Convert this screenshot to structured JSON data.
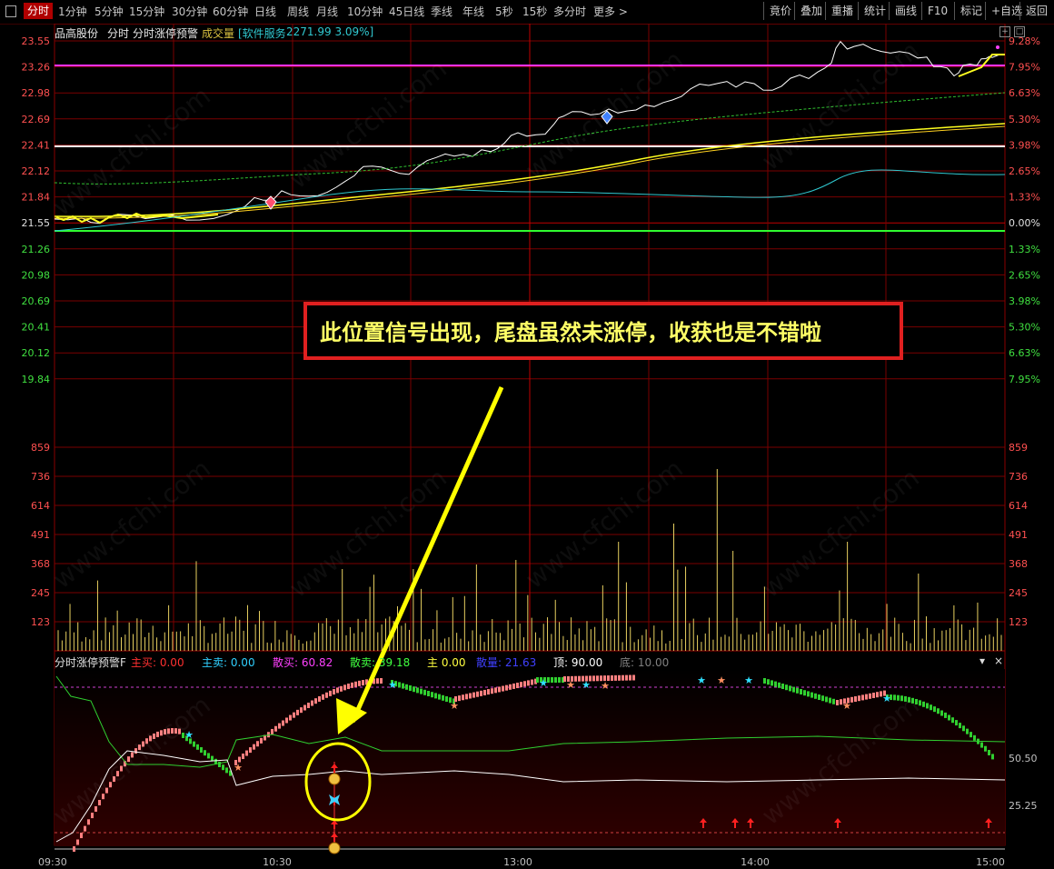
{
  "toolbar": {
    "tabs": [
      "分时",
      "1分钟",
      "5分钟",
      "15分钟",
      "30分钟",
      "60分钟",
      "日线",
      "周线",
      "月线",
      "10分钟",
      "45日线",
      "季线",
      "年线",
      "5秒",
      "15秒",
      "多分时",
      "更多 >"
    ],
    "right_buttons": [
      "竟价",
      "叠加",
      "重播",
      "统计",
      "画线",
      "F10",
      "标记",
      "+自选",
      "返回"
    ]
  },
  "header": {
    "stock_name": "品高股份",
    "mode": "分时",
    "indicator": "分时涨停预警",
    "volume_label": "成交量",
    "sector": "[软件服务",
    "sector_value": "2271.99 3.09%]"
  },
  "price_axis": {
    "left": [
      "23.55",
      "23.26",
      "22.98",
      "22.69",
      "22.41",
      "22.12",
      "21.84",
      "21.55",
      "21.26",
      "20.98",
      "20.69",
      "20.41",
      "20.12",
      "19.84"
    ],
    "right": [
      "9.28%",
      "7.95%",
      "6.63%",
      "5.30%",
      "3.98%",
      "2.65%",
      "1.33%",
      "0.00%",
      "1.33%",
      "2.65%",
      "3.98%",
      "5.30%",
      "6.63%",
      "7.95%"
    ]
  },
  "volume_axis": [
    "859",
    "736",
    "614",
    "491",
    "368",
    "245",
    "123"
  ],
  "indicator_legend": {
    "name": "分时涨停预警F",
    "items": [
      {
        "label": "主买:",
        "value": "0.00",
        "color": "#ff3030"
      },
      {
        "label": "主卖:",
        "value": "0.00",
        "color": "#30d0ff"
      },
      {
        "label": "散买:",
        "value": "60.82",
        "color": "#ff40ff"
      },
      {
        "label": "散卖:",
        "value": "39.18",
        "color": "#40ff40"
      },
      {
        "label": "主",
        "value": "0.00",
        "color": "#ffff40"
      },
      {
        "label": "散量:",
        "value": "21.63",
        "color": "#4040ff"
      },
      {
        "label": "顶:",
        "value": "90.00",
        "color": "#ffffff"
      },
      {
        "label": "底:",
        "value": "10.00",
        "color": "#808080"
      }
    ],
    "right_values": [
      "50.50",
      "25.25"
    ]
  },
  "time_axis": [
    "09:30",
    "10:30",
    "13:00",
    "14:00",
    "15:00"
  ],
  "callout": {
    "text": "此位置信号出现，尾盘虽然未涨停，收获也是不错啦"
  },
  "watermark": "www.cfchi.com",
  "colors": {
    "grid": "#7a0000",
    "up": "#ff4040",
    "down": "#40ff40",
    "price_line": "#ffffff",
    "avg_line": "#ffff00",
    "limit_line": "#ff00ff",
    "arrow": "#ffff00"
  }
}
